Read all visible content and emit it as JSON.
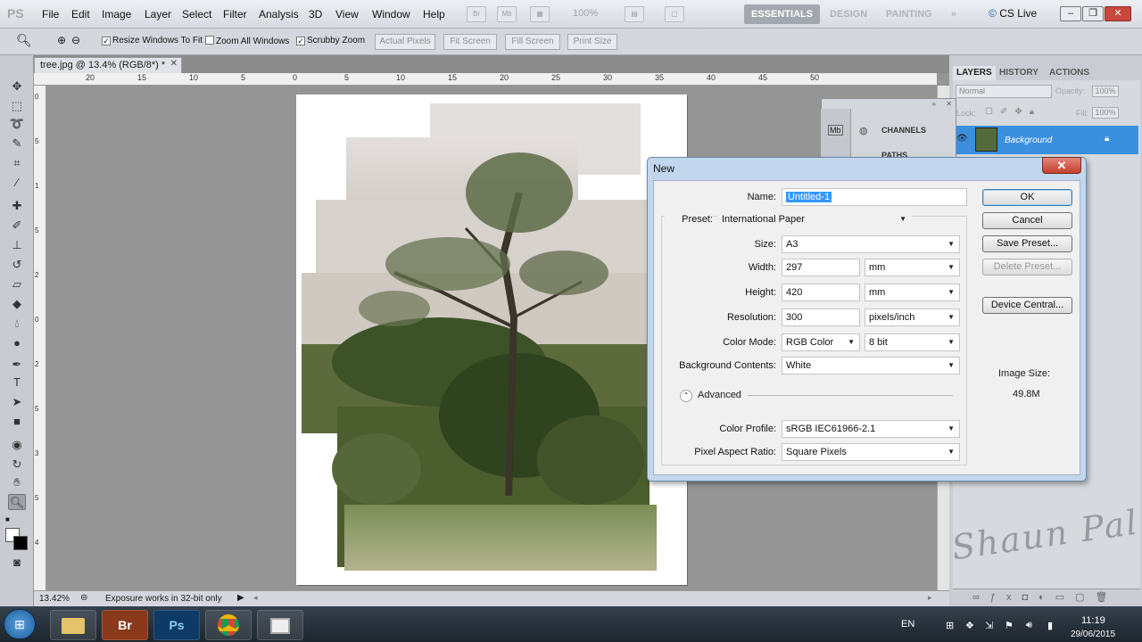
{
  "menubar": {
    "logo": "PS",
    "items": [
      "File",
      "Edit",
      "Image",
      "Layer",
      "Select",
      "Filter",
      "Analysis",
      "3D",
      "View",
      "Window",
      "Help"
    ],
    "zoom_level": "100%",
    "workspaces": [
      "ESSENTIALS",
      "DESIGN",
      "PAINTING"
    ],
    "more": "»",
    "cslive": "CS Live"
  },
  "options_bar": {
    "resize_windows": "Resize Windows To Fit",
    "zoom_all_windows": "Zoom All Windows",
    "scrubby_zoom": "Scrubby Zoom",
    "buttons": [
      "Actual Pixels",
      "Fit Screen",
      "Fill Screen",
      "Print Size"
    ]
  },
  "document": {
    "tab_title": "tree.jpg @ 13.4% (RGB/8*) *",
    "ruler_top": [
      "20",
      "15",
      "10",
      "5",
      "0",
      "5",
      "10",
      "15",
      "20",
      "25",
      "30",
      "35",
      "40",
      "45",
      "50"
    ],
    "ruler_left": [
      "0",
      "5",
      "1",
      "5",
      "2",
      "0",
      "2",
      "5",
      "3",
      "5",
      "4"
    ],
    "status_zoom": "13.42%",
    "status_message": "Exposure works in 32-bit only"
  },
  "panels": {
    "tabs": [
      "LAYERS",
      "HISTORY",
      "ACTIONS"
    ],
    "blend_mode": "Normal",
    "opacity_label": "Opacity:",
    "opacity_value": "100%",
    "lock_label": "Lock:",
    "fill_label": "Fill:",
    "fill_value": "100%",
    "layer_name": "Background",
    "channels": "CHANNELS",
    "paths": "PATHS",
    "watermark": "Shaun Pal"
  },
  "dialog": {
    "title": "New",
    "name_label": "Name:",
    "name_value": "Untitled-1",
    "preset_label": "Preset:",
    "preset_value": "International Paper",
    "size_label": "Size:",
    "size_value": "A3",
    "width_label": "Width:",
    "width_value": "297",
    "width_unit": "mm",
    "height_label": "Height:",
    "height_value": "420",
    "height_unit": "mm",
    "resolution_label": "Resolution:",
    "resolution_value": "300",
    "resolution_unit": "pixels/inch",
    "color_mode_label": "Color Mode:",
    "color_mode_value": "RGB Color",
    "bit_depth": "8 bit",
    "background_label": "Background Contents:",
    "background_value": "White",
    "advanced_label": "Advanced",
    "color_profile_label": "Color Profile:",
    "color_profile_value": "sRGB IEC61966-2.1",
    "pixel_aspect_label": "Pixel Aspect Ratio:",
    "pixel_aspect_value": "Square Pixels",
    "ok": "OK",
    "cancel": "Cancel",
    "save_preset": "Save Preset...",
    "delete_preset": "Delete Preset...",
    "device_central": "Device Central...",
    "image_size_label": "Image Size:",
    "image_size_value": "49.8M"
  },
  "taskbar": {
    "apps": [
      "Br",
      "Ps"
    ],
    "lang": "EN",
    "time": "11:19",
    "date": "29/06/2015"
  }
}
